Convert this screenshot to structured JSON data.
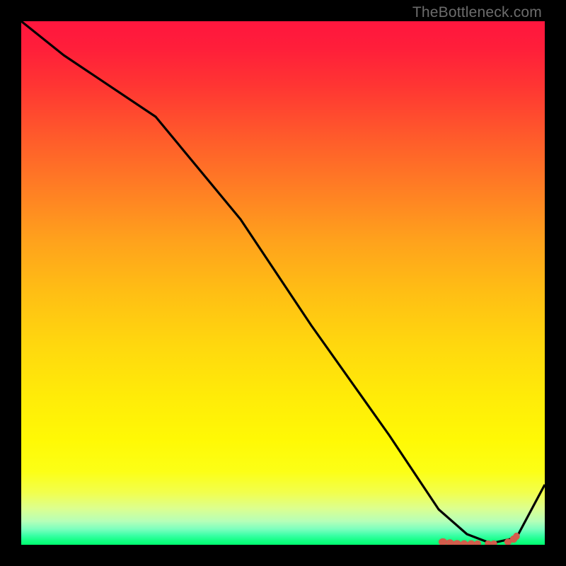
{
  "watermark": "TheBottleneck.com",
  "chart_data": {
    "type": "line",
    "title": "",
    "xlabel": "",
    "ylabel": "",
    "xlim": [
      0,
      100
    ],
    "ylim": [
      0,
      100
    ],
    "x": [
      0,
      10,
      25,
      40,
      55,
      70,
      80,
      86,
      90,
      94,
      100
    ],
    "values": [
      100,
      92,
      82,
      62,
      42,
      22,
      6,
      1,
      0,
      1,
      12
    ],
    "annotations": [
      {
        "type": "marker-cluster",
        "x_range": [
          80,
          94
        ],
        "y": 0,
        "color": "#d35d4c"
      }
    ]
  },
  "colors": {
    "line": "#000000",
    "marker": "#d35d4c",
    "background_top": "#ff163e",
    "background_bottom": "#00ff70",
    "frame": "#000000"
  }
}
